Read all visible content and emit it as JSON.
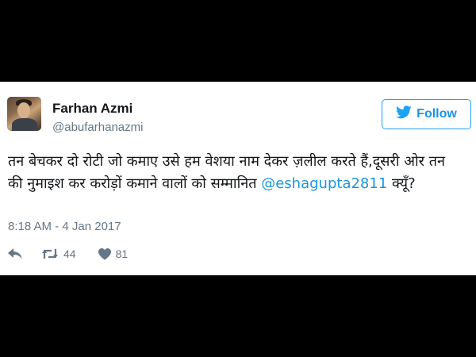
{
  "user": {
    "name": "Farhan Azmi",
    "handle": "@abufarhanazmi"
  },
  "follow_button": {
    "label": "Follow",
    "icon": "twitter-bird-icon",
    "color": "#1da1f2"
  },
  "tweet": {
    "text_part1": "तन बेचकर दो रोटी जो कमाए उसे हम वेशया नाम देकर ज़लील करते हैं,दूसरी ओर तन की नुमाइश कर करोड़ों कमाने वालों को सम्मानित ",
    "mention": "@eshagupta2811",
    "text_part2": " क्यूँ?",
    "timestamp": "8:18 AM - 4 Jan 2017"
  },
  "actions": {
    "reply_icon": "reply-icon",
    "retweet_icon": "retweet-icon",
    "retweet_count": "44",
    "like_icon": "heart-icon",
    "like_count": "81"
  }
}
